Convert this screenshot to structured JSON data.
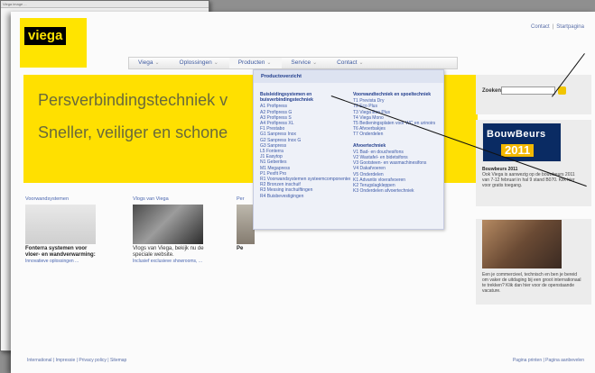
{
  "background_window": {
    "bar_text": "Viega image ..."
  },
  "logo": {
    "text": "viega"
  },
  "top_links": {
    "link1": "Contact",
    "link2": "Startpagina"
  },
  "nav": {
    "items": [
      "Viega",
      "Oplossingen",
      "Producten",
      "Service",
      "Contact"
    ]
  },
  "hero": {
    "line1": "Persverbindingstechniek v",
    "line2": "Sneller, veiliger en schone"
  },
  "dropdown": {
    "header": "Productoverzicht",
    "col1_group": "Buisleidingsystemen en buisverbindingstechniek",
    "col1_items": [
      "A1 Profipress",
      "A2 Profipress G",
      "A3 Profipress S",
      "A4 Profipress XL",
      "F1 Prestabo",
      "G1 Sanpress Inox",
      "G2 Sanpress Inox G",
      "G3 Sanpress",
      "L5 Fonterra",
      "J1 Easytop",
      "N1 Geberites",
      "M1 Megapress",
      "P1 Pexfit Pro",
      "R1 Voorwandsystemen systeemcomponenten",
      "R2 Bronzen inschuif",
      "R3 Messing inschuiftingen",
      "R4 Buisbevestigingen"
    ],
    "col2_group1": "Voorwandtechniek en spoeltechniek",
    "col2_items1": [
      "T1 Prevista Dry",
      "T2 Eco Plus",
      "T3 Viega Eco Plus",
      "T4 Viega Mono",
      "T5 Bedieningsplaten voor WC en urinoirs",
      "T6 Afvoerbakjes",
      "T7 Onderdelen"
    ],
    "col2_group2": "Afvoertechniek",
    "col2_items2": [
      "V1 Bad- en douchesifons",
      "V2 Wastafel- en bidetsifons",
      "V3 Gootsteen- en wasmachinesifons",
      "V4 Dakafvoeren",
      "V5 Onderdelen",
      "K1 Advantix vloerafvoeren",
      "K2 Terugslagkleppen",
      "K3 Onderdelen afvoertechniek"
    ]
  },
  "sidebar": {
    "search_label": "Zoeken:",
    "fair_banner_line1": "BouwBeurs",
    "fair_banner_line2": "2011",
    "fair_title": "Bouwbeurs 2011",
    "fair_text": "Ook Viega is aanwezig op de bouwbeurs 2011 van 7-12 februari in hal 9 stand B070. Klik hier voor gratis toegang.",
    "team_text": "Een je commercieel, technisch en ben je bereid om vaker de uitdaging bij een groot internationaal te trekken? Klik dan hier voor de openstaande vacature."
  },
  "columns": [
    {
      "title": "Voorwandsystemen",
      "head": "Fonterra systemen voor vloer- en wandverwarming:",
      "sub": "Innovatieve oplossingen ..."
    },
    {
      "title": "Vlogs van Viega",
      "head": "Vlogs van Viega, bekijk nu de speciale website.",
      "sub": "Inclusief exclusieve showrooms, ..."
    },
    {
      "title": "Per",
      "head": "Pe",
      "sub": ""
    }
  ],
  "footer": {
    "left": "International | Impressie | Privacy policy | Sitemap",
    "right": "Pagina printen | Pagina aanbevelen"
  }
}
